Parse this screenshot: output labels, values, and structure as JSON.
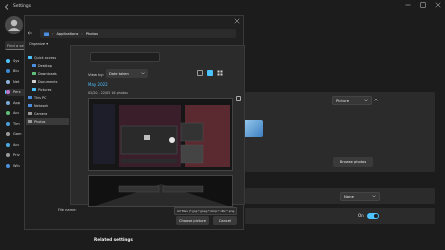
{
  "settings": {
    "title": "Settings",
    "search_placeholder": "Find a setting",
    "nav_items": [
      {
        "label": "Sys",
        "color": "#4cc2ff"
      },
      {
        "label": "Blu",
        "color": "#3a8ad6"
      },
      {
        "label": "Net",
        "color": "#8fb3d9"
      },
      {
        "label": "Pers",
        "color": "#c07ad6"
      },
      {
        "label": "App",
        "color": "#7aa8d6"
      },
      {
        "label": "Acc",
        "color": "#5fbf7a"
      },
      {
        "label": "Tim",
        "color": "#4a9fd9"
      },
      {
        "label": "Gam",
        "color": "#9a9a9a"
      },
      {
        "label": "Acc",
        "color": "#4aa9e0"
      },
      {
        "label": "Priv",
        "color": "#9a9a9a"
      },
      {
        "label": "Win",
        "color": "#4c8fe0"
      }
    ],
    "active_nav_index": 3,
    "background_select": "Picture",
    "browse_button": "Browse photos",
    "fit_select": "None",
    "toggle_label": "On",
    "related_heading": "Related settings"
  },
  "dialog": {
    "breadcrumb": [
      "Applications",
      "Photos"
    ],
    "organize": "Organize",
    "tree": [
      {
        "label": "Quick access",
        "icon_color": "#4cc2ff",
        "indent": 0
      },
      {
        "label": "Desktop",
        "icon_color": "#4c8fe0",
        "indent": 1
      },
      {
        "label": "Downloads",
        "icon_color": "#5fbf7a",
        "indent": 1
      },
      {
        "label": "Documents",
        "icon_color": "#cfcfcf",
        "indent": 1
      },
      {
        "label": "Pictures",
        "icon_color": "#4cc2ff",
        "indent": 1
      },
      {
        "label": "This PC",
        "icon_color": "#4c8fe0",
        "indent": 0
      },
      {
        "label": "Network",
        "icon_color": "#4c8fe0",
        "indent": 0
      },
      {
        "label": "Camera",
        "icon_color": "#9a9a9a",
        "indent": 0
      },
      {
        "label": "Photos",
        "icon_color": "#9a9a9a",
        "indent": 0
      }
    ],
    "selected_tree_index": 8,
    "file_name_label": "File name:",
    "filter": "All files (*.jpg;*.jpeg;*.bmp;*.dib;*.png",
    "choose_button": "Choose picture",
    "cancel_button": "Cancel"
  },
  "photos": {
    "view_by_label": "View by:",
    "view_by_value": "Date taken",
    "month": "May 2022",
    "summary": "05/20 - 22/05   16 photos"
  }
}
